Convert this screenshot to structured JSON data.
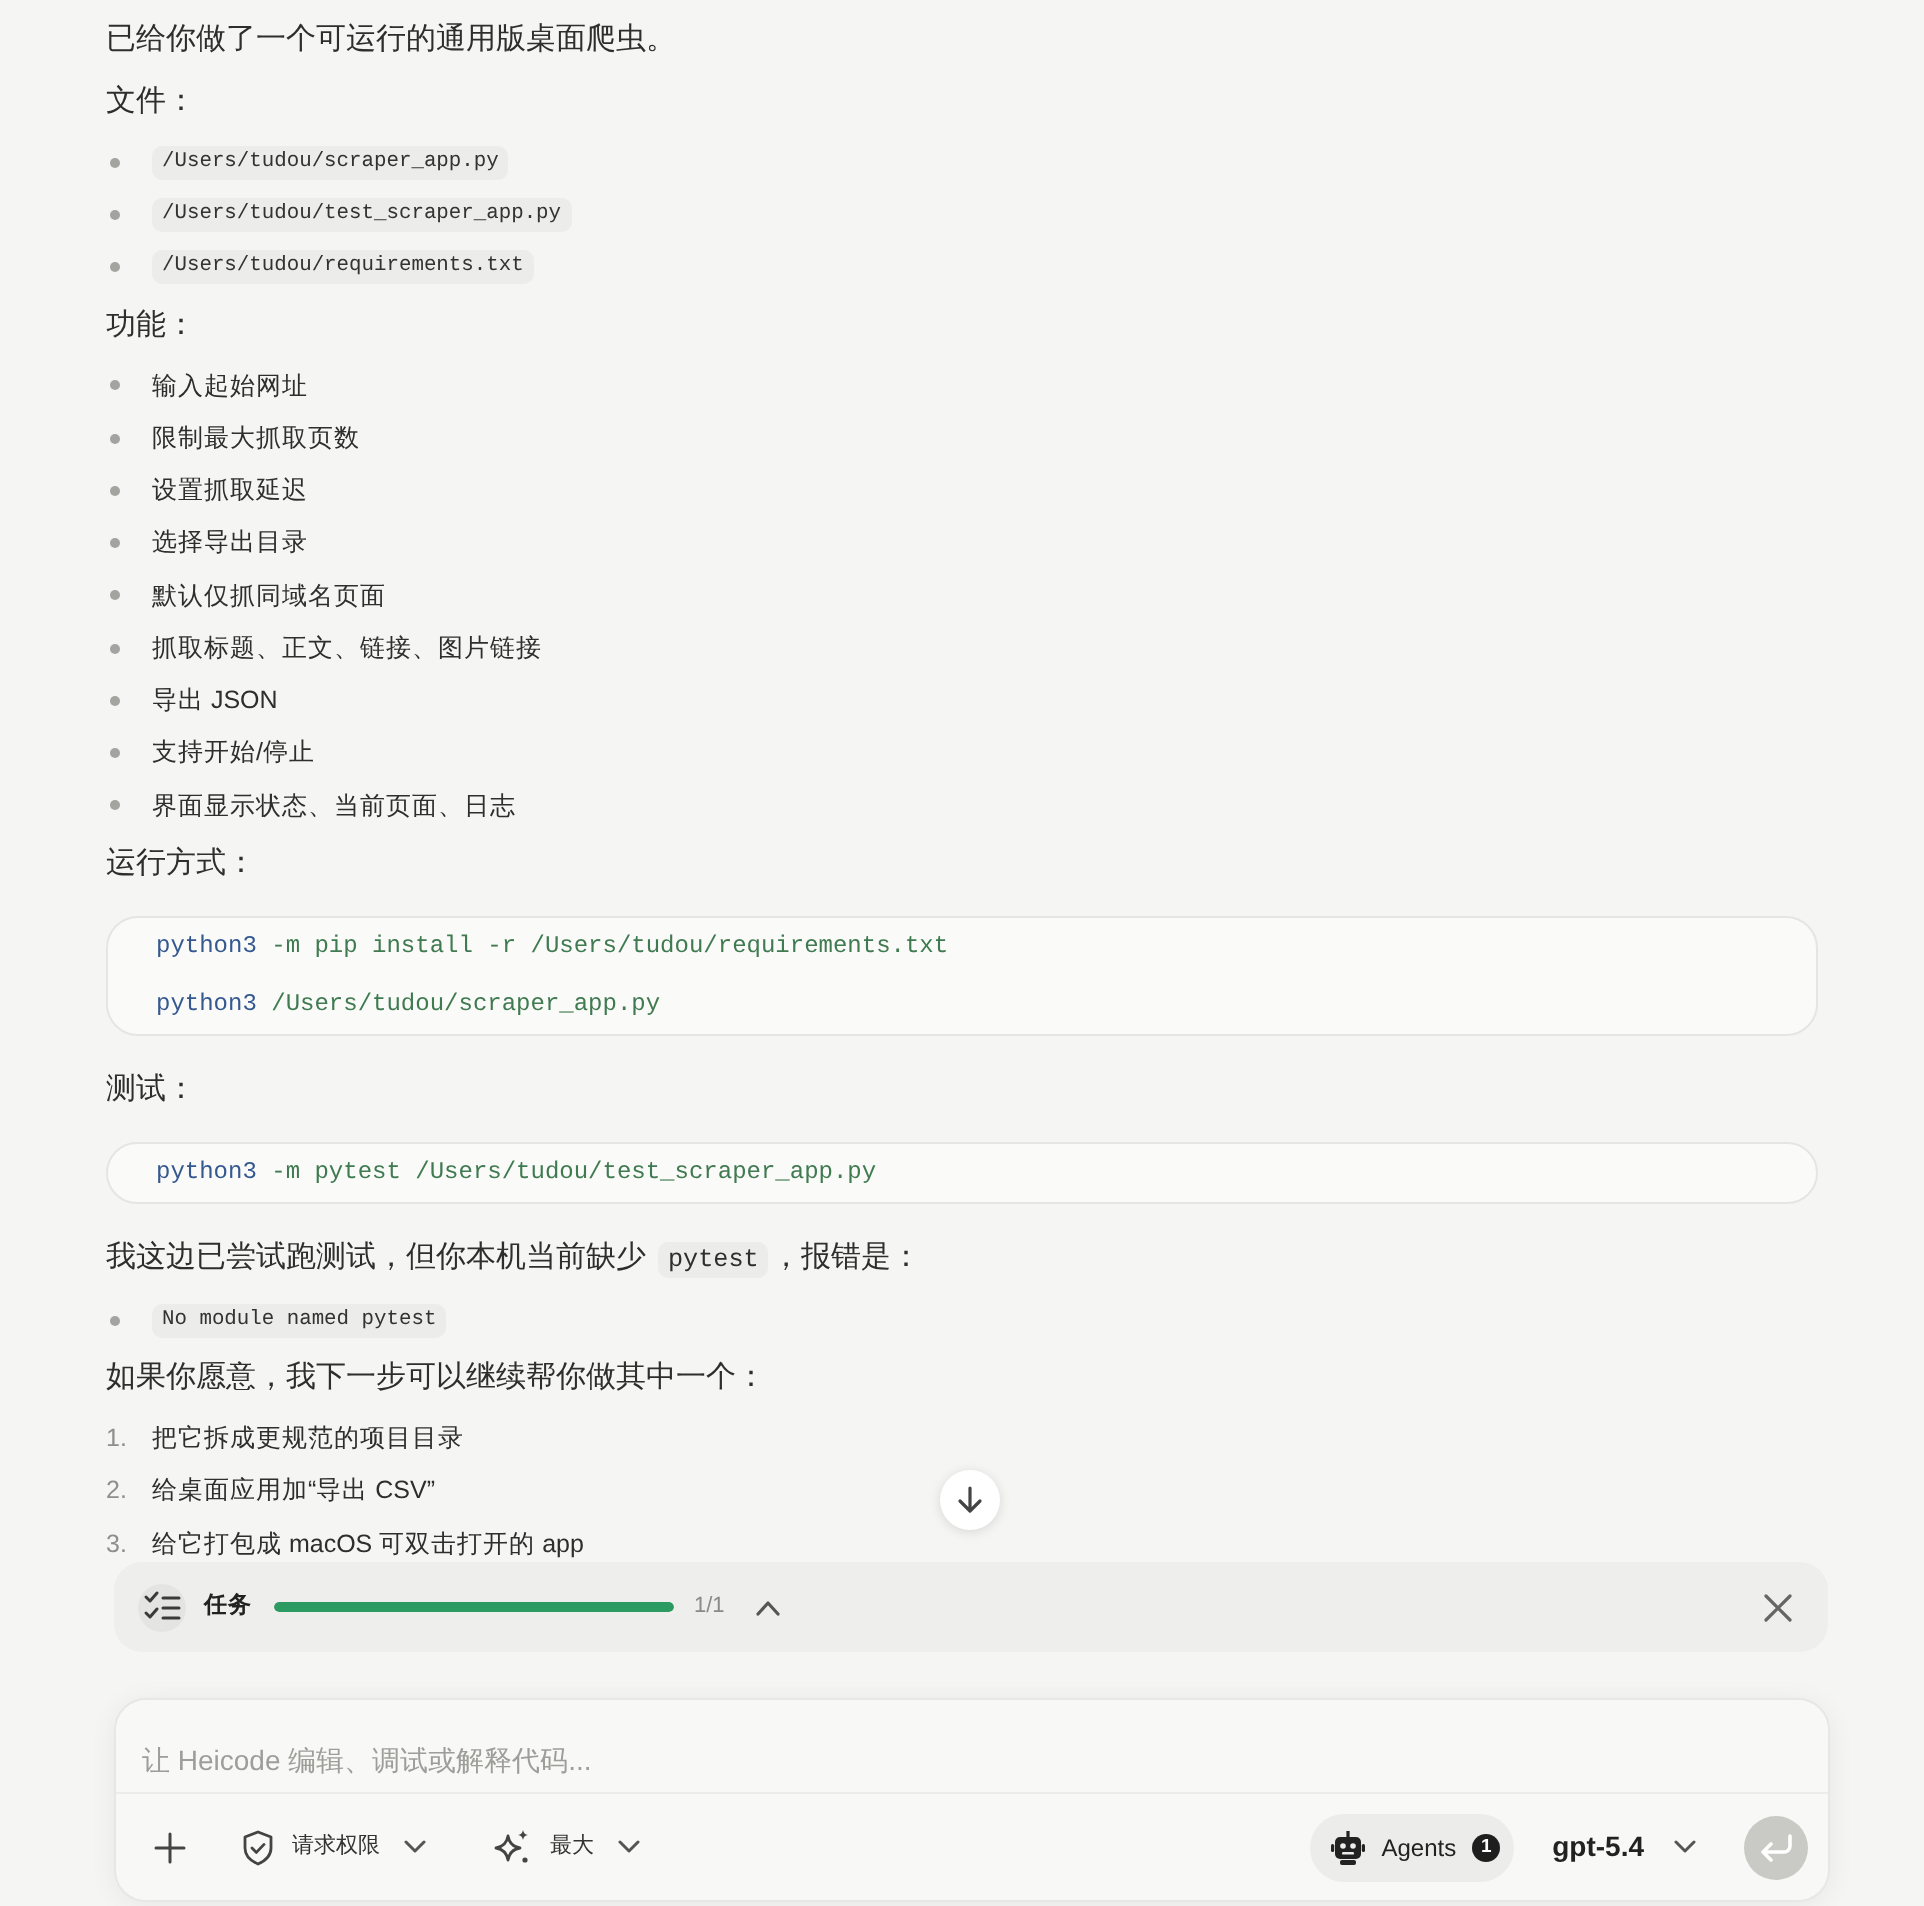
{
  "message": {
    "blocks": [
      {
        "kind": "paragraph",
        "parts": [
          {
            "kind": "text",
            "text": "已给你做了一个可运行的通用版桌面爬虫。"
          }
        ]
      },
      {
        "kind": "paragraph",
        "parts": [
          {
            "kind": "text",
            "text": "文件："
          }
        ]
      },
      {
        "kind": "bullet_list",
        "items": [
          {
            "kind": "code",
            "text": "/Users/tudou/scraper_app.py"
          },
          {
            "kind": "code",
            "text": "/Users/tudou/test_scraper_app.py"
          },
          {
            "kind": "code",
            "text": "/Users/tudou/requirements.txt"
          }
        ]
      },
      {
        "kind": "paragraph",
        "parts": [
          {
            "kind": "text",
            "text": "功能："
          }
        ]
      },
      {
        "kind": "bullet_list",
        "items": [
          {
            "kind": "text",
            "text": "输入起始网址"
          },
          {
            "kind": "text",
            "text": "限制最大抓取页数"
          },
          {
            "kind": "text",
            "text": "设置抓取延迟"
          },
          {
            "kind": "text",
            "text": "选择导出目录"
          },
          {
            "kind": "text",
            "text": "默认仅抓同域名页面"
          },
          {
            "kind": "text",
            "text": "抓取标题、正文、链接、图片链接"
          },
          {
            "kind": "text",
            "text": "导出 JSON"
          },
          {
            "kind": "text",
            "text": "支持开始/停止"
          },
          {
            "kind": "text",
            "text": "界面显示状态、当前页面、日志"
          }
        ]
      },
      {
        "kind": "paragraph",
        "parts": [
          {
            "kind": "text",
            "text": "运行方式："
          }
        ]
      },
      {
        "kind": "code_block",
        "lines": [
          [
            {
              "kind": "command",
              "text": "python3"
            },
            {
              "kind": "argument",
              "text": "-m pip install -r /Users/tudou/requirements.txt"
            }
          ],
          [
            {
              "kind": "command",
              "text": "python3"
            },
            {
              "kind": "argument",
              "text": "/Users/tudou/scraper_app.py"
            }
          ]
        ]
      },
      {
        "kind": "paragraph",
        "parts": [
          {
            "kind": "text",
            "text": "测试："
          }
        ]
      },
      {
        "kind": "code_block",
        "lines": [
          [
            {
              "kind": "command",
              "text": "python3"
            },
            {
              "kind": "argument",
              "text": "-m pytest /Users/tudou/test_scraper_app.py"
            }
          ]
        ]
      },
      {
        "kind": "paragraph",
        "parts": [
          {
            "kind": "text",
            "text": "我这边已尝试跑测试，但你本机当前缺少"
          },
          {
            "kind": "code",
            "text": "pytest"
          },
          {
            "kind": "text",
            "text": "，报错是："
          }
        ]
      },
      {
        "kind": "bullet_list",
        "items": [
          {
            "kind": "code",
            "text": "No module named pytest"
          }
        ]
      },
      {
        "kind": "paragraph",
        "parts": [
          {
            "kind": "text",
            "text": "如果你愿意，我下一步可以继续帮你做其中一个："
          }
        ]
      },
      {
        "kind": "numbered_list",
        "items": [
          {
            "number": "1.",
            "text": "把它拆成更规范的项目目录"
          },
          {
            "number": "2.",
            "text": "给桌面应用加“导出 CSV”"
          },
          {
            "number": "3.",
            "text": "给它打包成 macOS 可双击打开的 app"
          }
        ]
      }
    ]
  },
  "task_bar": {
    "label": "任务",
    "progress": {
      "level": 1
    },
    "count": "1/1"
  },
  "composer": {
    "placeholder": "让 Heicode 编辑、调试或解释代码...",
    "tools": [
      {
        "kind": "shield",
        "label": "请求权限"
      },
      {
        "kind": "sparkle",
        "label": "最大"
      }
    ],
    "agents": {
      "label": "Agents",
      "count": "1"
    },
    "model": "gpt-5.4",
    "send_button": {
      "disabled": true
    }
  }
}
